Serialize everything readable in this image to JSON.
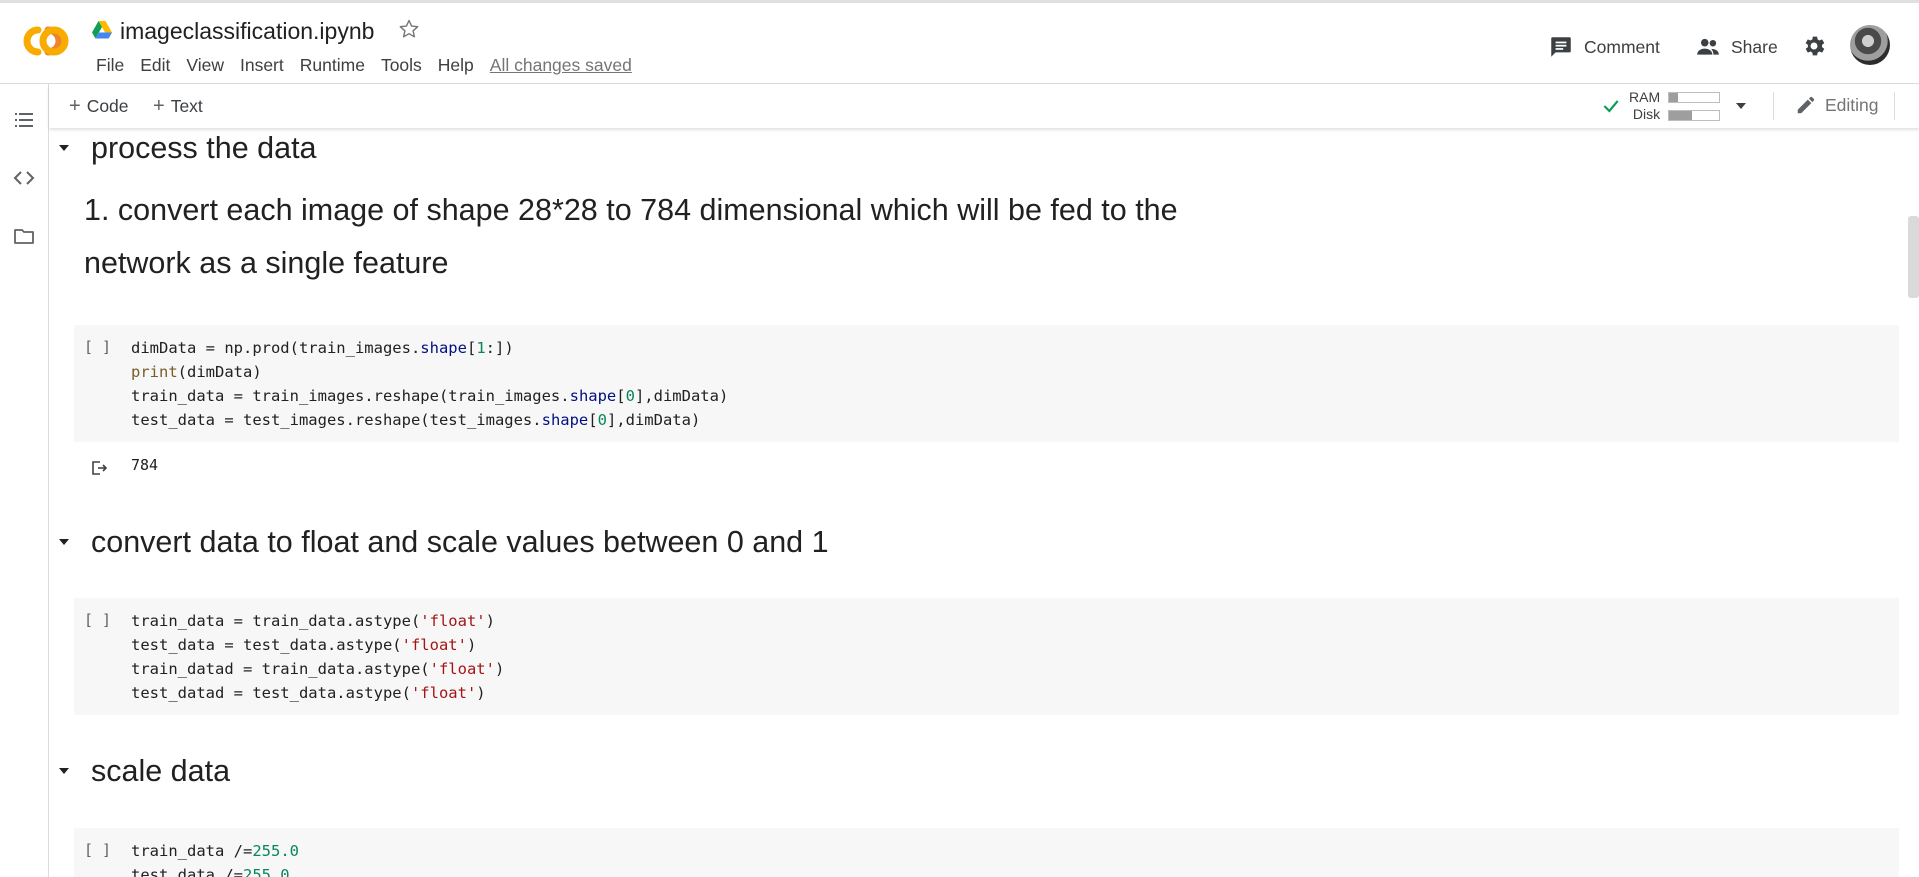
{
  "app": {
    "file_name": "imageclassification.ipynb",
    "menu": [
      "File",
      "Edit",
      "View",
      "Insert",
      "Runtime",
      "Tools",
      "Help"
    ],
    "save_status": "All changes saved",
    "comment_label": "Comment",
    "share_label": "Share"
  },
  "toolbar": {
    "add_code_label": "Code",
    "add_text_label": "Text",
    "ram_label": "RAM",
    "disk_label": "Disk",
    "ram_usage": 0.18,
    "disk_usage": 0.45,
    "mode_label": "Editing"
  },
  "notebook": {
    "section1_title": "process the data",
    "section1_text_line1": "1. convert each image of shape 28*28 to 784 dimensional which will be fed to the",
    "section1_text_line2": "network as a single feature",
    "cell1_bracket": "[ ]",
    "cell1_output": "784",
    "section2_title": "convert data to float and scale values between 0 and 1",
    "cell2_bracket": "[ ]",
    "section3_title": "scale data",
    "cell3_bracket": "[ ]"
  }
}
